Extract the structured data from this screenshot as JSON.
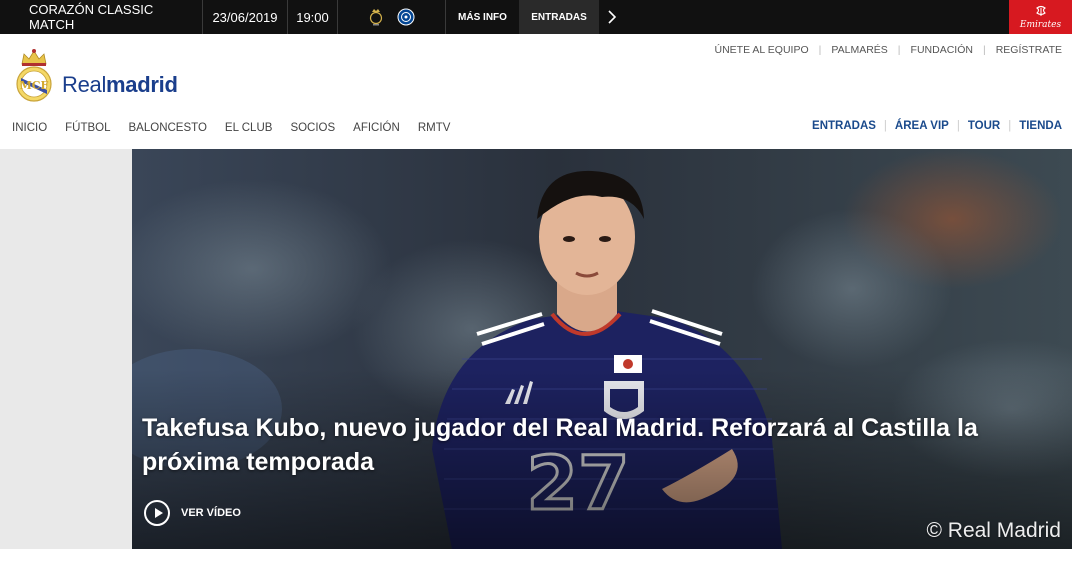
{
  "topbar": {
    "event": "CORAZÓN CLASSIC MATCH",
    "date": "23/06/2019",
    "time": "19:00",
    "home_team_icon": "real-madrid-crest",
    "away_team_icon": "chelsea-crest",
    "mas_info": "MÁS INFO",
    "entradas": "ENTRADAS",
    "arrow_icon": "chevron-right",
    "sponsor": "Emirates",
    "sponsor_color": "#d71920"
  },
  "header": {
    "logo_light": "Real",
    "logo_bold": "madrid",
    "brand_color": "#1a3e8c",
    "util_links": [
      "ÚNETE AL EQUIPO",
      "PALMARÉS",
      "FUNDACIÓN",
      "REGÍSTRATE"
    ],
    "main_nav": [
      "INICIO",
      "FÚTBOL",
      "BALONCESTO",
      "EL CLUB",
      "SOCIOS",
      "AFICIÓN",
      "RMTV"
    ],
    "right_nav": [
      "ENTRADAS",
      "ÁREA VIP",
      "TOUR",
      "TIENDA"
    ]
  },
  "hero": {
    "title": "Takefusa Kubo, nuevo jugador del Real Madrid. Reforzará al Castilla la próxima temporada",
    "video_label": "VER VÍDEO",
    "copyright": "© Real Madrid",
    "shirt_number": "27"
  }
}
